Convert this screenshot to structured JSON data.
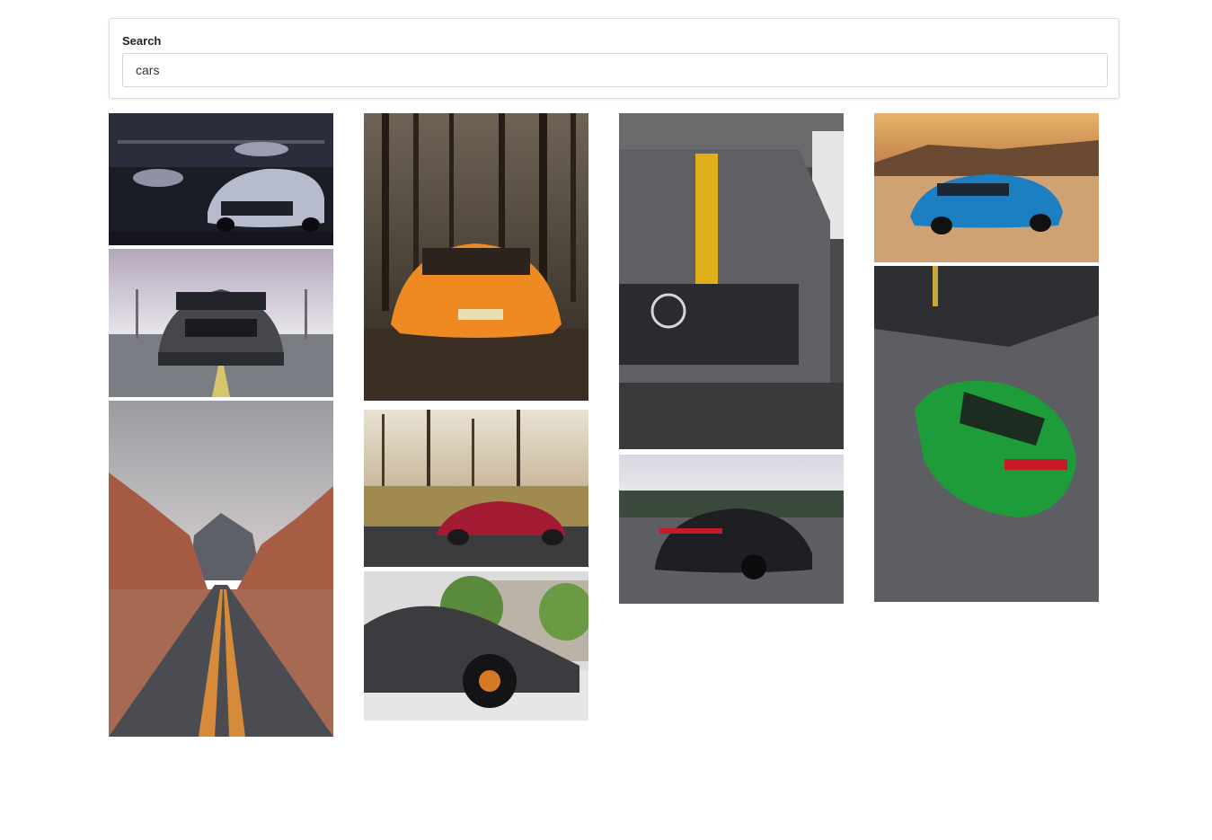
{
  "search": {
    "label": "Search",
    "value": "cars"
  },
  "results": [
    {
      "icon": "camaro-garage-photo"
    },
    {
      "icon": "mustang-front-photo"
    },
    {
      "icon": "desert-road-photo"
    },
    {
      "icon": "lamborghini-forest-photo"
    },
    {
      "icon": "mercedes-amg-red-photo"
    },
    {
      "icon": "lamborghini-side-photo"
    },
    {
      "icon": "mercedes-grille-photo"
    },
    {
      "icon": "porsche-panamera-photo"
    },
    {
      "icon": "camaro-blue-desert-photo"
    },
    {
      "icon": "mustang-green-top-photo"
    }
  ]
}
